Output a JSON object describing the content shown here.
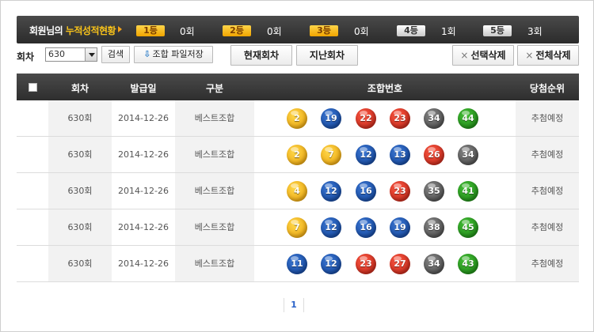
{
  "stats": {
    "title_prefix": "회원님의 ",
    "title_highlight": "누적성적현황",
    "ranks": [
      {
        "label": "1등",
        "count": "0회",
        "style": "gold"
      },
      {
        "label": "2등",
        "count": "0회",
        "style": "gold"
      },
      {
        "label": "3등",
        "count": "0회",
        "style": "gold"
      },
      {
        "label": "4등",
        "count": "1회",
        "style": "silver"
      },
      {
        "label": "5등",
        "count": "3회",
        "style": "silver"
      }
    ]
  },
  "controls": {
    "round_label": "회차",
    "round_value": "630",
    "search_label": "검색",
    "save_label": "조합 파일저장",
    "current_round_label": "현재회차",
    "past_round_label": "지난회차",
    "delete_selected_label": "선택삭제",
    "delete_all_label": "전체삭제"
  },
  "table": {
    "headers": {
      "round": "회차",
      "issue_date": "발급일",
      "type": "구분",
      "numbers": "조합번호",
      "rank": "당첨순위"
    },
    "rows": [
      {
        "round": "630회",
        "issue_date": "2014-12-26",
        "type": "베스트조합",
        "rank": "추첨예정",
        "balls": [
          {
            "n": "2",
            "c": "yellow"
          },
          {
            "n": "19",
            "c": "blue"
          },
          {
            "n": "22",
            "c": "red"
          },
          {
            "n": "23",
            "c": "red"
          },
          {
            "n": "34",
            "c": "gray"
          },
          {
            "n": "44",
            "c": "green"
          }
        ]
      },
      {
        "round": "630회",
        "issue_date": "2014-12-26",
        "type": "베스트조합",
        "rank": "추첨예정",
        "balls": [
          {
            "n": "2",
            "c": "yellow"
          },
          {
            "n": "7",
            "c": "yellow"
          },
          {
            "n": "12",
            "c": "blue"
          },
          {
            "n": "13",
            "c": "blue"
          },
          {
            "n": "26",
            "c": "red"
          },
          {
            "n": "34",
            "c": "gray"
          }
        ]
      },
      {
        "round": "630회",
        "issue_date": "2014-12-26",
        "type": "베스트조합",
        "rank": "추첨예정",
        "balls": [
          {
            "n": "4",
            "c": "yellow"
          },
          {
            "n": "12",
            "c": "blue"
          },
          {
            "n": "16",
            "c": "blue"
          },
          {
            "n": "23",
            "c": "red"
          },
          {
            "n": "35",
            "c": "gray"
          },
          {
            "n": "41",
            "c": "green"
          }
        ]
      },
      {
        "round": "630회",
        "issue_date": "2014-12-26",
        "type": "베스트조합",
        "rank": "추첨예정",
        "balls": [
          {
            "n": "7",
            "c": "yellow"
          },
          {
            "n": "12",
            "c": "blue"
          },
          {
            "n": "16",
            "c": "blue"
          },
          {
            "n": "19",
            "c": "blue"
          },
          {
            "n": "38",
            "c": "gray"
          },
          {
            "n": "45",
            "c": "green"
          }
        ]
      },
      {
        "round": "630회",
        "issue_date": "2014-12-26",
        "type": "베스트조합",
        "rank": "추첨예정",
        "balls": [
          {
            "n": "11",
            "c": "blue"
          },
          {
            "n": "12",
            "c": "blue"
          },
          {
            "n": "23",
            "c": "red"
          },
          {
            "n": "27",
            "c": "red"
          },
          {
            "n": "34",
            "c": "gray"
          },
          {
            "n": "43",
            "c": "green"
          }
        ]
      }
    ]
  },
  "pagination": {
    "current_page": "1"
  },
  "colors": {
    "header_bg": "#333333",
    "highlight": "#f7c21a",
    "page_link": "#2a62c9"
  }
}
